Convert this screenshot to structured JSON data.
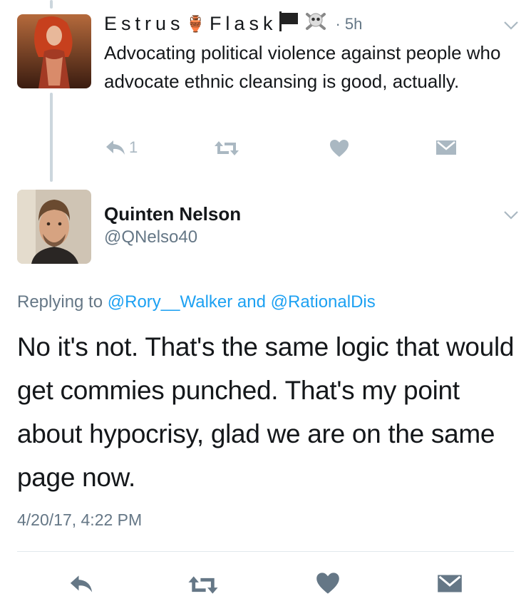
{
  "tweet1": {
    "display_name_part1": "Estrus",
    "emoji_amphora": "🏺",
    "display_name_part2": "Flask",
    "emoji_flag": "🏴",
    "emoji_skull": "☠️",
    "time": "· 5h",
    "text": "Advocating political violence against people who advocate ethnic cleansing is good, actually.",
    "reply_count": "1",
    "icons": [
      "reply-icon",
      "retweet-icon",
      "heart-icon",
      "dm-envelope-icon",
      "chevron-down-icon"
    ]
  },
  "tweet2": {
    "display_name": "Quinten Nelson",
    "handle": "@QNelso40",
    "replying_prefix": "Replying to ",
    "replying_user1": "@Rory__Walker",
    "replying_and": " and ",
    "replying_user2": "@RationalDis",
    "text": "No it's not. That's the same logic that would get commies punched. That's my point about hypocrisy, glad we are on the same page now.",
    "timestamp": "4/20/17, 4:22 PM",
    "icons": [
      "reply-icon",
      "retweet-icon",
      "heart-icon",
      "dm-envelope-icon",
      "chevron-down-icon"
    ]
  },
  "colors": {
    "text": "#14171a",
    "secondary": "#657786",
    "link": "#1da1f2",
    "icon_light": "#aab8c2",
    "thread_line": "#ccd6dd",
    "divider": "#e1e8ed"
  }
}
